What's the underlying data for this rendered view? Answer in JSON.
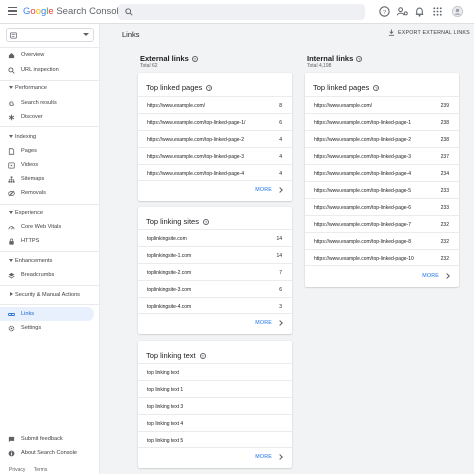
{
  "header": {
    "brand_google": "Google",
    "brand_product": "Search Console",
    "search_placeholder": ""
  },
  "sidebar": {
    "top_items": [
      {
        "label": "Overview"
      },
      {
        "label": "URL inspection"
      }
    ],
    "sections": [
      {
        "label": "Performance",
        "items": [
          "Search results",
          "Discover"
        ]
      },
      {
        "label": "Indexing",
        "items": [
          "Pages",
          "Videos",
          "Sitemaps",
          "Removals"
        ]
      },
      {
        "label": "Experience",
        "items": [
          "Core Web Vitals",
          "HTTPS"
        ]
      },
      {
        "label": "Enhancements",
        "items": [
          "Breadcrumbs"
        ]
      },
      {
        "label": "Security & Manual Actions",
        "items": []
      }
    ],
    "bottom_items": [
      {
        "label": "Links",
        "active": true
      },
      {
        "label": "Settings"
      }
    ],
    "footer_items": [
      "Submit feedback",
      "About Search Console"
    ],
    "footer_links": [
      "Privacy",
      "Terms"
    ]
  },
  "main": {
    "title": "Links",
    "export_label": "EXPORT EXTERNAL LINKS",
    "external": {
      "title": "External links",
      "total": "Total 62",
      "top_linked_pages": {
        "title": "Top linked pages",
        "rows": [
          {
            "k": "https://www.example.com/",
            "v": "8"
          },
          {
            "k": "https://www.example.com/top-linked-page-1/",
            "v": "6"
          },
          {
            "k": "https://www.example.com/top-linked-page-2",
            "v": "4"
          },
          {
            "k": "https://www.example.com/top-linked-page-3",
            "v": "4"
          },
          {
            "k": "https://www.example.com/top-linked-page-4",
            "v": "4"
          }
        ],
        "more": "MORE"
      },
      "top_linking_sites": {
        "title": "Top linking sites",
        "rows": [
          {
            "k": "toplinkingsite.com",
            "v": "14"
          },
          {
            "k": "toplinkingsite-1.com",
            "v": "14"
          },
          {
            "k": "toplinkingsite-2.com",
            "v": "7"
          },
          {
            "k": "toplinkingsite-3.com",
            "v": "6"
          },
          {
            "k": "toplinkingsite-4.com",
            "v": "3"
          }
        ],
        "more": "MORE"
      },
      "top_linking_text": {
        "title": "Top linking text",
        "rows": [
          {
            "k": "top linking text",
            "v": ""
          },
          {
            "k": "top linking text 1",
            "v": ""
          },
          {
            "k": "top linking text 3",
            "v": ""
          },
          {
            "k": "top linking text 4",
            "v": ""
          },
          {
            "k": "top linking text 5",
            "v": ""
          }
        ],
        "more": "MORE"
      }
    },
    "internal": {
      "title": "Internal links",
      "total": "Total 4,198",
      "top_linked_pages": {
        "title": "Top linked pages",
        "rows": [
          {
            "k": "https://www.example.com/",
            "v": "239"
          },
          {
            "k": "https://www.example.com/top-linked-page-1",
            "v": "238"
          },
          {
            "k": "https://www.example.com/top-linked-page-2",
            "v": "238"
          },
          {
            "k": "https://www.example.com/top-linked-page-3",
            "v": "237"
          },
          {
            "k": "https://www.example.com/top-linked-page-4",
            "v": "234"
          },
          {
            "k": "https://www.example.com/top-linked-page-5",
            "v": "233"
          },
          {
            "k": "https://www.example.com/top-linked-page-6",
            "v": "233"
          },
          {
            "k": "https://www.example.com/top-linked-page-7",
            "v": "232"
          },
          {
            "k": "https://www.example.com/top-linked-page-8",
            "v": "232"
          },
          {
            "k": "https://www.example.com/top-linked-page-10",
            "v": "232"
          }
        ],
        "more": "MORE"
      }
    }
  },
  "colors": {
    "accent": "#1a73e8",
    "active_bg": "#e8f0fe",
    "page_bg": "#f1f3f4"
  }
}
